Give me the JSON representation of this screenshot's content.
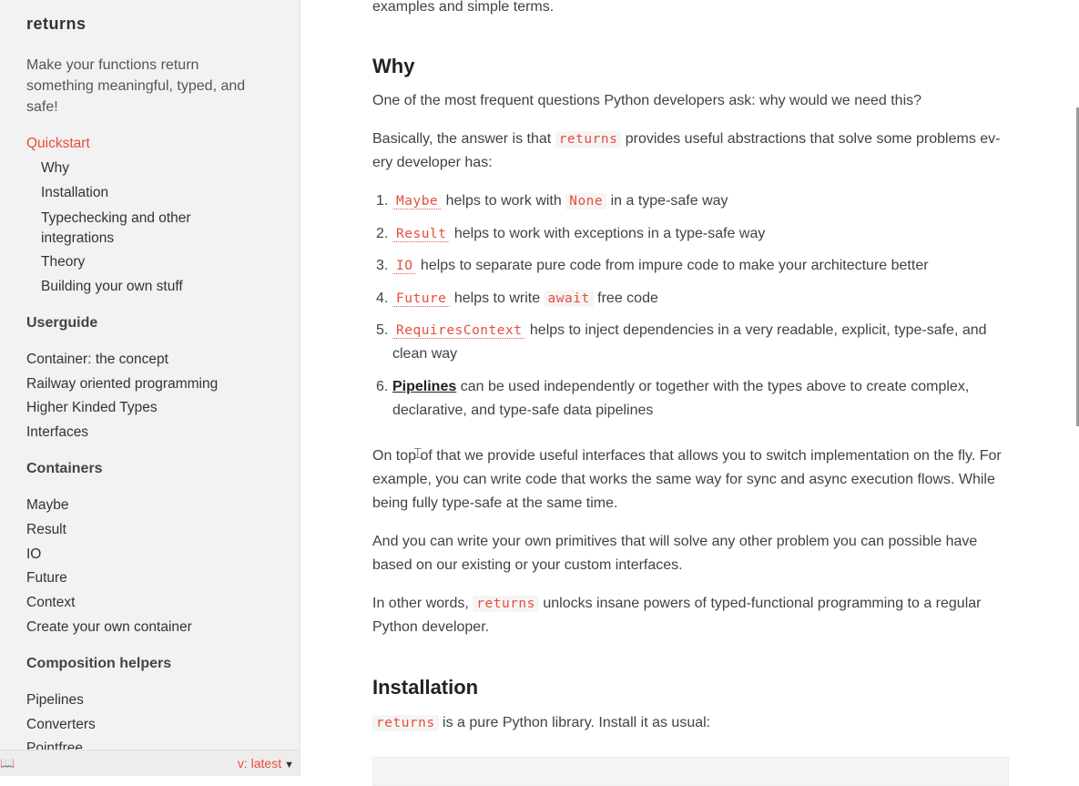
{
  "sidebar": {
    "brand": "returns",
    "tagline": "Make your functions return something meaningful, typed, and safe!",
    "quickstart": {
      "label": "Quickstart",
      "items": [
        "Why",
        "Installation",
        "Typechecking and other integrations",
        "Theory",
        "Building your own stuff"
      ]
    },
    "userguide": {
      "heading": "Userguide",
      "items": [
        "Container: the concept",
        "Railway oriented programming",
        "Higher Kinded Types",
        "Interfaces"
      ]
    },
    "containers": {
      "heading": "Containers",
      "items": [
        "Maybe",
        "Result",
        "IO",
        "Future",
        "Context",
        "Create your own container"
      ]
    },
    "composition": {
      "heading": "Composition helpers",
      "items": [
        "Pipelines",
        "Converters",
        "Pointfree"
      ]
    },
    "version": "v: latest",
    "book_icon": "book-icon",
    "caret_icon": "caret-down-icon"
  },
  "main": {
    "intro_tail": "examples and simple terms.",
    "why": {
      "title": "Why",
      "p1": "One of the most frequent questions Python developers ask: why would we need this?",
      "p2_a": "Basically, the answer is that ",
      "p2_code": "returns",
      "p2_b": " provides useful abstractions that solve some problems ev-",
      "p2_c": "ery developer has:",
      "list": [
        {
          "num": "1.",
          "code": "Maybe",
          "text_a": " helps to work with ",
          "code2": "None",
          "text_b": " in a type-safe way"
        },
        {
          "num": "2.",
          "code": "Result",
          "text_a": " helps to work with exceptions in a type-safe way"
        },
        {
          "num": "3.",
          "code": "IO",
          "text_a": " helps to separate pure code from impure code to make your architecture better"
        },
        {
          "num": "4.",
          "code": "Future",
          "text_a": " helps to write ",
          "code2": "await",
          "text_b": " free code"
        },
        {
          "num": "5.",
          "code": "RequiresContext",
          "text_a": " helps to inject dependencies in a very readable, explicit, type-safe, and",
          "text_c": "clean way"
        },
        {
          "num": "6.",
          "link": "Pipelines",
          "text_a": " can be used independently or together with the types above to create complex,",
          "text_c": "declarative, and type-safe data pipelines"
        }
      ],
      "p3_l1": "On top of that we provide useful interfaces that allows you to switch implementation on the fly. For",
      "p3_l2": "example, you can write code that works the same way for sync and async execution flows. While",
      "p3_l3": "being fully type-safe at the same time.",
      "p4_l1": "And you can write your own primitives that will solve any other problem you can possible have",
      "p4_l2": "based on our existing or your custom interfaces.",
      "p5_a": "In other words, ",
      "p5_code": "returns",
      "p5_b": " unlocks insane powers of typed-functional programming to a regular",
      "p5_c": "Python developer."
    },
    "installation": {
      "title": "Installation",
      "code": "returns",
      "text": " is a pure Python library. Install it as usual:"
    }
  },
  "colors": {
    "accent": "#e74c3c",
    "sidebar_bg": "#f2f2f2"
  }
}
